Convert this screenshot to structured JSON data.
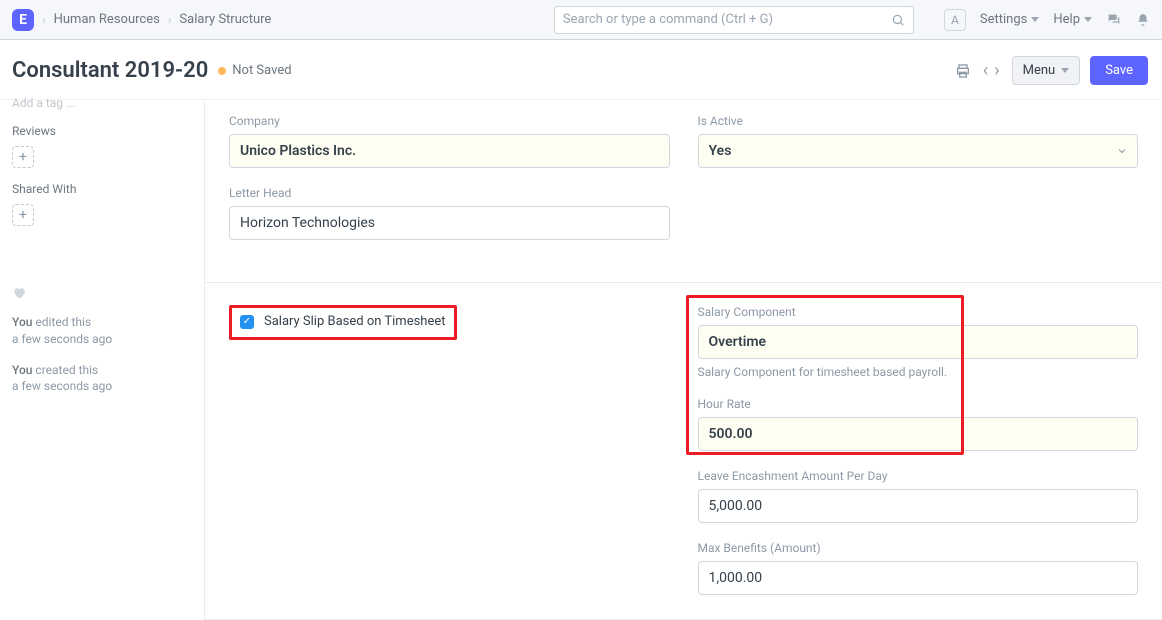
{
  "navbar": {
    "logo_letter": "E",
    "breadcrumb1": "Human Resources",
    "breadcrumb2": "Salary Structure",
    "search_placeholder": "Search or type a command (Ctrl + G)",
    "key_hint": "A",
    "settings_label": "Settings",
    "help_label": "Help"
  },
  "title": {
    "heading": "Consultant 2019-20",
    "status": "Not Saved",
    "menu_label": "Menu",
    "save_label": "Save"
  },
  "sidebar": {
    "add_tag_hint": "Add a tag ...",
    "reviews_label": "Reviews",
    "shared_label": "Shared With",
    "plus": "+",
    "timeline": [
      {
        "who": "You",
        "action": "edited this",
        "ago": "a few seconds ago"
      },
      {
        "who": "You",
        "action": "created this",
        "ago": "a few seconds ago"
      }
    ]
  },
  "form": {
    "company_label": "Company",
    "company_value": "Unico Plastics Inc.",
    "letterhead_label": "Letter Head",
    "letterhead_value": "Horizon Technologies",
    "is_active_label": "Is Active",
    "is_active_value": "Yes",
    "timesheet_checkbox_label": "Salary Slip Based on Timesheet",
    "salary_component_label": "Salary Component",
    "salary_component_value": "Overtime",
    "salary_component_help": "Salary Component for timesheet based payroll.",
    "hour_rate_label": "Hour Rate",
    "hour_rate_value": "500.00",
    "leave_encash_label": "Leave Encashment Amount Per Day",
    "leave_encash_value": "5,000.00",
    "max_benefits_label": "Max Benefits (Amount)",
    "max_benefits_value": "1,000.00"
  }
}
